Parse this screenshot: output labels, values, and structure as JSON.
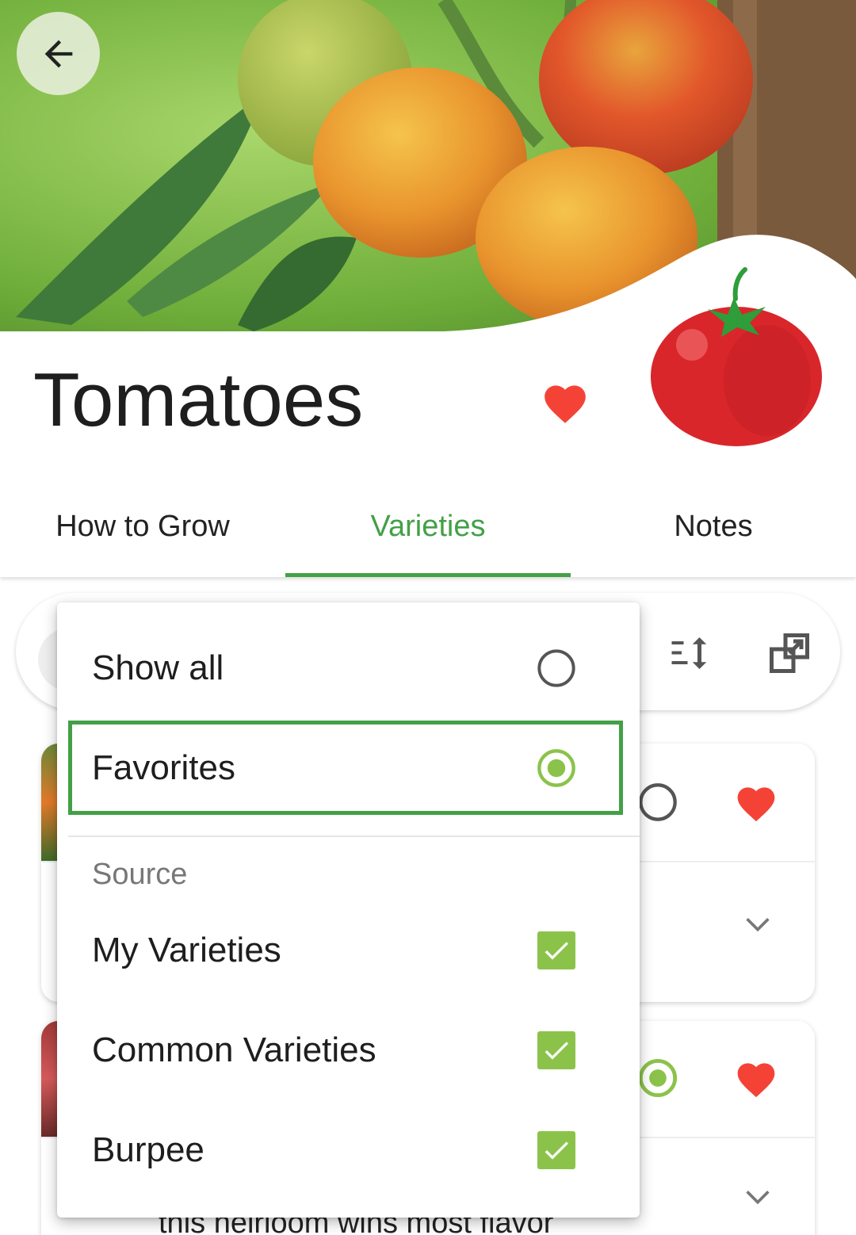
{
  "header": {
    "title": "Tomatoes",
    "back_icon": "arrow-left-icon",
    "favorite_icon": "heart-icon",
    "favorite_color": "#f44336"
  },
  "tabs": [
    {
      "label": "How to Grow",
      "active": false
    },
    {
      "label": "Varieties",
      "active": true
    },
    {
      "label": "Notes",
      "active": false
    }
  ],
  "accent_color": "#43a047",
  "toolbar": {
    "sort_icon": "sort-icon",
    "expand_icon": "expand-icon"
  },
  "filter_menu": {
    "show_all": {
      "label": "Show all",
      "selected": false
    },
    "favorites": {
      "label": "Favorites",
      "selected": true
    },
    "source_header": "Source",
    "sources": [
      {
        "label": "My Varieties",
        "checked": true
      },
      {
        "label": "Common Varieties",
        "checked": true
      },
      {
        "label": "Burpee",
        "checked": true
      }
    ]
  },
  "background_cards": {
    "peek_text": "this heirloom wins most flavor"
  }
}
